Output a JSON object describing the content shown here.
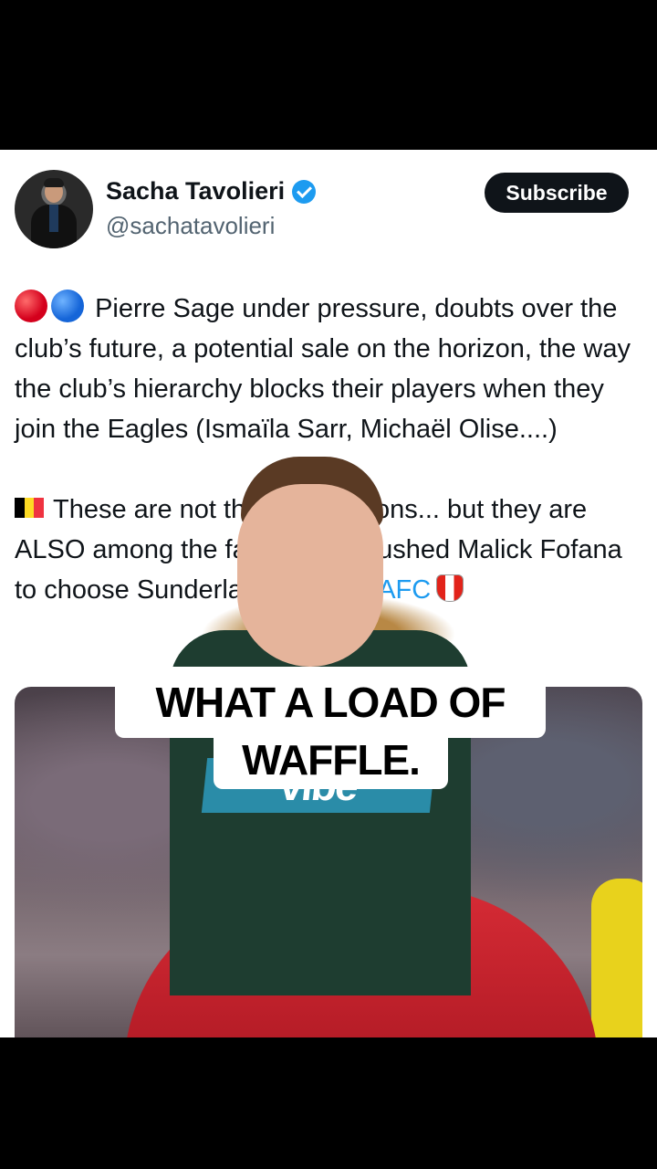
{
  "author": {
    "name": "Sacha Tavolieri",
    "handle": "@sachatavolieri",
    "verified": true
  },
  "actions": {
    "subscribe_label": "Subscribe"
  },
  "tweet": {
    "paragraph1": "Pierre Sage under pressure, doubts over the club’s future, a potential sale on the horizon, the way the club’s hierarchy blocks their players when they join the Eagles (Ismaïla Sarr, Michaël Olise....)",
    "paragraph2_text": "These are not the only reasons... but they are ALSO among the factors that pushed Malick Fofana to choose Sunderland AFC.",
    "hashtag": "#SAFC"
  },
  "overlay": {
    "caption_line1": "WHAT A LOAD OF",
    "caption_line2": "WAFFLE.",
    "shirt_sponsor": "vibe"
  },
  "colors": {
    "accent": "#1d9bf0",
    "button_bg": "#0f1419",
    "text": "#0f1419",
    "secondary_text": "#536471"
  },
  "icons": {
    "verified": "verified-badge-icon",
    "dot_red": "red-circle-icon",
    "dot_blue": "blue-circle-icon",
    "flag": "belgium-flag-icon",
    "crest": "sunderland-crest-icon"
  }
}
